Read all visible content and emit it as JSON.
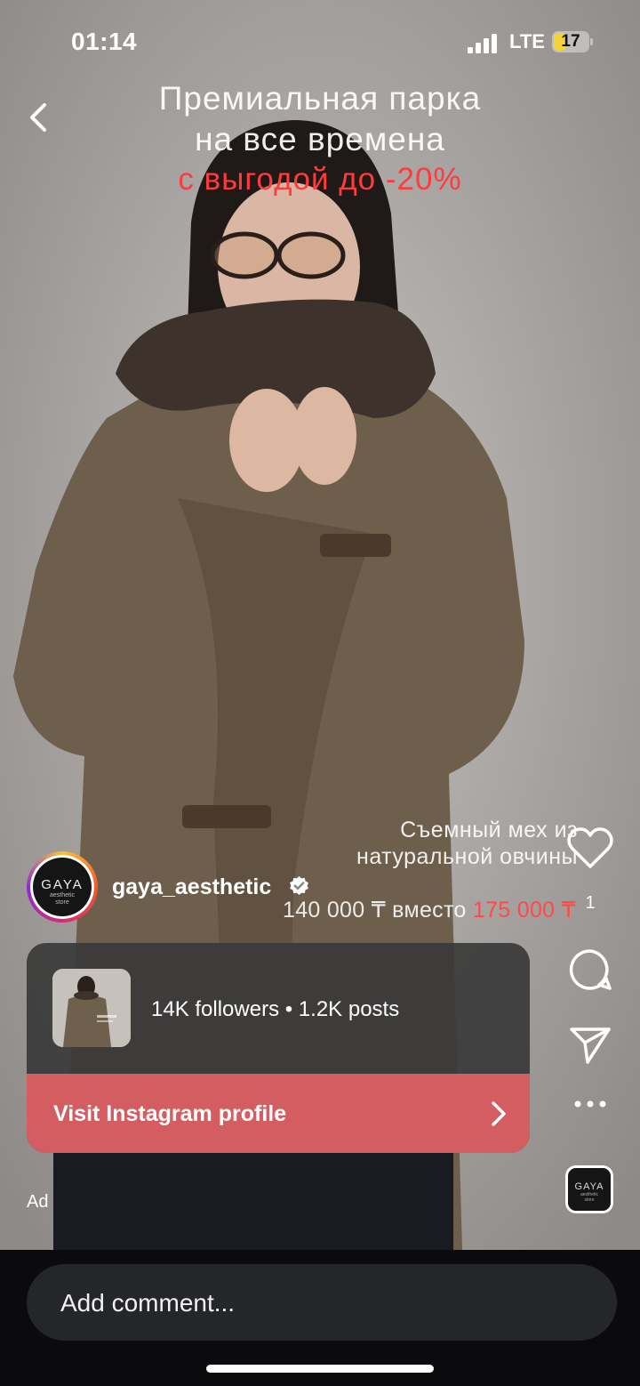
{
  "status_bar": {
    "time": "01:14",
    "network": "LTE",
    "battery_level": "17",
    "battery_color": "#f2d43a"
  },
  "ad_creative": {
    "headline_line1": "Премиальная парка",
    "headline_line2": "на все времена",
    "headline_promo": "с выгодой до -20%",
    "fur_line1": "Съемный мех из",
    "fur_line2": "натуральной овчины",
    "price_new": "140 000 ₸ вместо",
    "price_old": "175 000 ₸"
  },
  "account": {
    "username": "gaya_aesthetic",
    "avatar_brand": "GAYA",
    "avatar_sub1": "aesthetic",
    "avatar_sub2": "store",
    "verified": true
  },
  "profile_card": {
    "stats": "14K followers • 1.2K posts",
    "cta_label": "Visit Instagram profile",
    "cta_color": "#d35d60"
  },
  "sponsored_label": "Ad",
  "actions": {
    "like_count": "1",
    "icons": [
      "heart-icon",
      "comment-icon",
      "share-icon",
      "more-icon",
      "audio-thumbnail"
    ]
  },
  "comment": {
    "placeholder": "Add comment..."
  }
}
